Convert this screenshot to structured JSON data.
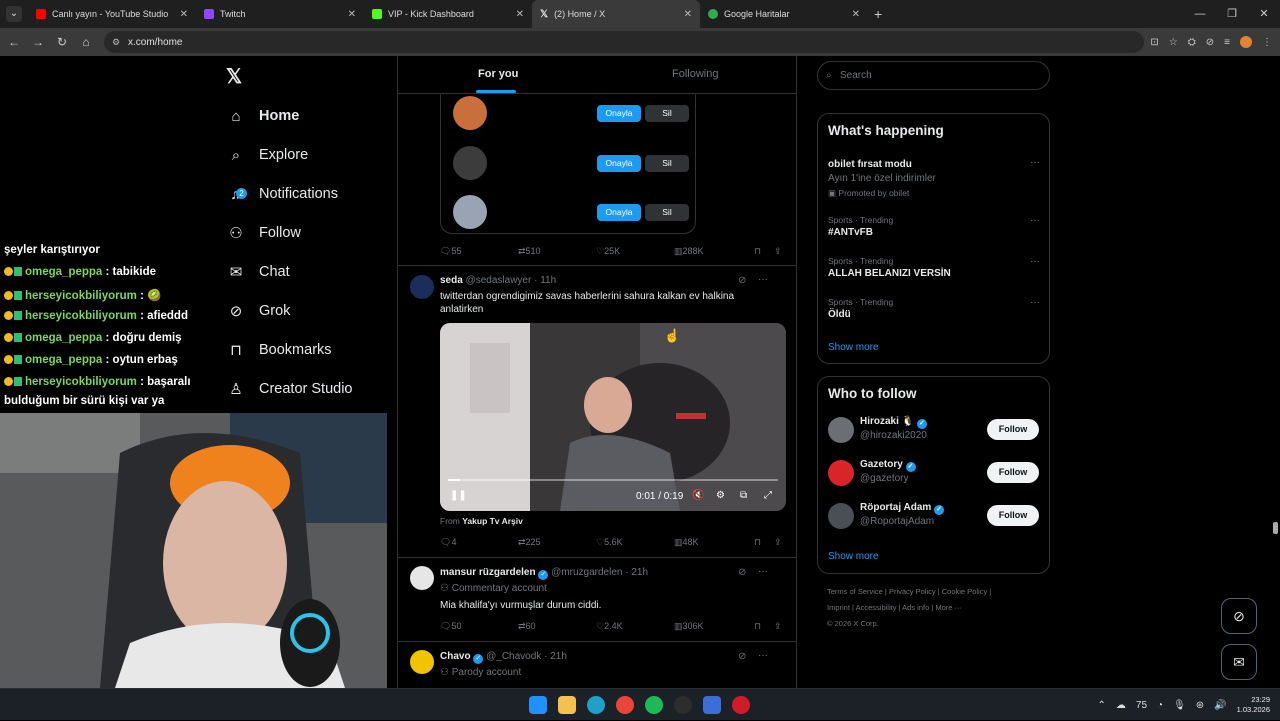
{
  "browser": {
    "tabs": [
      {
        "title": "Canlı yayın - YouTube Studio",
        "color": "#ff0000",
        "active": false
      },
      {
        "title": "Twitch",
        "color": "#9146ff",
        "active": false
      },
      {
        "title": "VIP - Kick Dashboard",
        "color": "#53fc18",
        "active": false
      },
      {
        "title": "(2) Home / X",
        "color": "#ffffff",
        "active": true
      },
      {
        "title": "Google Haritalar",
        "color": "#34a853",
        "active": false
      }
    ],
    "url": "x.com/home"
  },
  "stream_chat": {
    "lines": [
      {
        "prefix": "şeyler karıştırıyor",
        "user": "",
        "message": ""
      },
      {
        "user": "omega_peppa",
        "message": ": tabikide"
      },
      {
        "user": "herseyicokbiliyorum",
        "message": ": 🥝"
      },
      {
        "user": "herseyicokbiliyorum",
        "message": ": afieddd"
      },
      {
        "user": "omega_peppa",
        "message": ": doğru demiş"
      },
      {
        "user": "omega_peppa",
        "message": ": oytun erbaş"
      },
      {
        "user": "herseyicokbiliyorum",
        "message": ": başaralı"
      },
      {
        "prefix": "bulduğum bir sürü kişi var ya",
        "user": "",
        "message": ""
      }
    ]
  },
  "x_nav": {
    "items": [
      {
        "label": "Home",
        "icon": "home-icon"
      },
      {
        "label": "Explore",
        "icon": "search-icon"
      },
      {
        "label": "Notifications",
        "icon": "bell-icon",
        "badge": "2"
      },
      {
        "label": "Follow",
        "icon": "add-person-icon"
      },
      {
        "label": "Chat",
        "icon": "mail-icon"
      },
      {
        "label": "Grok",
        "icon": "grok-icon"
      },
      {
        "label": "Bookmarks",
        "icon": "bookmark-icon"
      },
      {
        "label": "Creator Studio",
        "icon": "creator-icon"
      }
    ]
  },
  "feed": {
    "tabs": {
      "for_you": "For you",
      "following": "Following"
    },
    "requests": {
      "approve": "Onayla",
      "delete": "Sil"
    },
    "post1": {
      "replies": "55",
      "reposts": "510",
      "likes": "25K",
      "views": "288K"
    },
    "post2": {
      "name": "seda",
      "handle": "@sedaslawyer · 11h",
      "text": "twitterdan ogrendigimiz savas haberlerini sahura kalkan ev halkina anlatirken",
      "video_time": "0:01 / 0:19",
      "from_label": "From",
      "from_source": "Yakup Tv Arşiv",
      "replies": "4",
      "reposts": "225",
      "likes": "5.6K",
      "views": "48K"
    },
    "post3": {
      "name": "mansur rüzgardelen",
      "handle": "@mruzgardelen · 21h",
      "label": "Commentary account",
      "text": "Mia khalifa'yı vurmuşlar durum ciddi.",
      "replies": "50",
      "reposts": "60",
      "likes": "2.4K",
      "views": "306K"
    },
    "post4": {
      "name": "Chavo",
      "handle": "@_Chavodk · 21h",
      "label": "Parody account"
    }
  },
  "sidebar": {
    "search_placeholder": "Search",
    "whats_happening": "What's happening",
    "trends": [
      {
        "category": "",
        "name": "obilet fırsat modu",
        "sub": "Ayın 1'ine özel indirimler",
        "promo": "Promoted by obilet"
      },
      {
        "category": "Sports · Trending",
        "name": "#ANTvFB"
      },
      {
        "category": "Sports · Trending",
        "name": "ALLAH BELANIZI VERSİN"
      },
      {
        "category": "Sports · Trending",
        "name": "Öldü"
      }
    ],
    "show_more": "Show more",
    "who_to_follow": "Who to follow",
    "follow_label": "Follow",
    "suggestions": [
      {
        "name": "Hirozaki 🐧",
        "handle": "@hirozaki2020",
        "color": "#6b6e73"
      },
      {
        "name": "Gazetory",
        "handle": "@gazetory",
        "color": "#d9252a"
      },
      {
        "name": "Röportaj Adam",
        "handle": "@RoportajAdam",
        "color": "#4a4f56"
      }
    ],
    "footer": {
      "line1": "Terms of Service  |  Privacy Policy  |  Cookie Policy  |",
      "line2": "Imprint  |  Accessibility  |  Ads info  |  More ···",
      "line3": "© 2026 X Corp."
    }
  },
  "taskbar": {
    "temperature": "75",
    "time": "23:29",
    "date": "1.03.2026"
  },
  "colors": {
    "accent": "#1d9bf0",
    "background": "#000000"
  }
}
